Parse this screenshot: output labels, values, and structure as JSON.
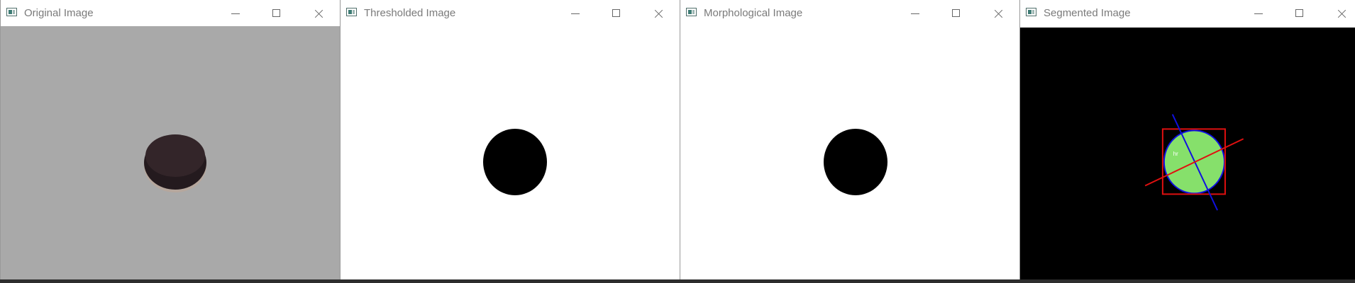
{
  "windows": [
    {
      "title": "Original Image"
    },
    {
      "title": "Thresholded Image"
    },
    {
      "title": "Morphological Image"
    },
    {
      "title": "Segmented Image"
    }
  ],
  "segmented_overlay_text": "hr",
  "colors": {
    "original_bg": "#a9a9a9",
    "object_dark": "#2a1c20",
    "binary_bg": "#ffffff",
    "binary_object": "#000000",
    "segmented_bg": "#000000",
    "segmented_fill": "#86e06b",
    "bounding_box": "#e01010",
    "minor_axis": "#e01010",
    "major_axis": "#1010e0",
    "contour": "#1010e0"
  }
}
